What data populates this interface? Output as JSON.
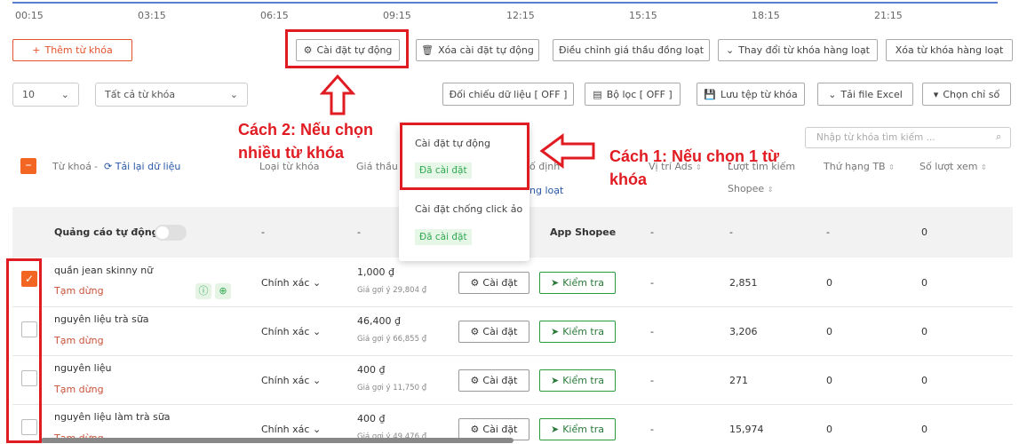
{
  "timeline": {
    "ticks": [
      "00:15",
      "03:15",
      "06:15",
      "09:15",
      "12:15",
      "15:15",
      "18:15",
      "21:15"
    ]
  },
  "toolbar1": {
    "add_keyword": "Thêm từ khóa",
    "auto_setup": "Cài đặt tự động",
    "remove_auto": "Xóa cài đặt tự động",
    "bulk_bid": "Điều chỉnh giá thầu đồng loạt",
    "bulk_change": "Thay đổi từ khóa hàng loạt",
    "bulk_delete": "Xóa từ khóa hàng loạt"
  },
  "toolbar2": {
    "page_size": "10",
    "filter_all": "Tất cả từ khóa",
    "reconcile": "Đối chiếu dữ liệu [ OFF ]",
    "filter": "Bộ lọc [ OFF ]",
    "save": "Lưu tệp từ khóa",
    "download": "Tải file Excel",
    "choose_metric": "Chọn chỉ số"
  },
  "search": {
    "placeholder": "Nhập từ khóa tìm kiếm ..."
  },
  "annotations": {
    "method2_line1": "Cách 2: Nếu chọn",
    "method2_line2": "nhiều từ khóa",
    "method1_line1": "Cách 1: Nếu chọn 1 từ",
    "method1_line2": "khóa"
  },
  "popup": {
    "auto_setup": "Cài đặt tự động",
    "auto_status": "Đã cài đặt",
    "anti_click": "Cài đặt chống click ảo",
    "anti_status": "Đã cài đặt"
  },
  "table": {
    "headers": {
      "keyword": "Từ khoá",
      "reload": "Tải lại dữ liệu",
      "type": "Loại từ khóa",
      "bid": "Giá thầu",
      "fixed_partial": "ố định",
      "bulk_partial": "ng loạt",
      "ads_position": "Vị trí Ads",
      "search_volume": "Lượt tìm kiếm",
      "search_volume2": "Shopee",
      "avg_rank": "Thứ hạng TB",
      "views": "Số lượt xem"
    },
    "auto_row": {
      "label": "Quảng cáo tự động",
      "type": "-",
      "bid": "-",
      "position": "App Shopee",
      "ads": "-",
      "search": "-",
      "rank": "-",
      "views": "0"
    },
    "rows": [
      {
        "keyword": "quần jean skinny nữ",
        "status": "Tạm dừng",
        "type": "Chính xác",
        "bid": "1,000 ₫",
        "suggest": "Giá gợi ý 29,804 ₫",
        "setup": "Cài đặt",
        "check": "Kiểm tra",
        "ads": "-",
        "search": "2,851",
        "rank": "0",
        "views": "0",
        "checked": true
      },
      {
        "keyword": "nguyên liệu trà sữa",
        "status": "Tạm dừng",
        "type": "Chính xác",
        "bid": "46,400 ₫",
        "suggest": "Giá gợi ý 66,855 ₫",
        "setup": "Cài đặt",
        "check": "Kiểm tra",
        "ads": "-",
        "search": "3,206",
        "rank": "0",
        "views": "0",
        "checked": false
      },
      {
        "keyword": "nguyên liệu",
        "status": "Tạm dừng",
        "type": "Chính xác",
        "bid": "400 ₫",
        "suggest": "Giá gợi ý 11,750 ₫",
        "setup": "Cài đặt",
        "check": "Kiểm tra",
        "ads": "-",
        "search": "271",
        "rank": "0",
        "views": "0",
        "checked": false
      },
      {
        "keyword": "nguyên liệu làm trà sữa",
        "status": "Tạm dừng",
        "type": "Chính xác",
        "bid": "400 ₫",
        "suggest": "Giá gợi ý 49,476 ₫",
        "setup": "Cài đặt",
        "check": "Kiểm tra",
        "ads": "-",
        "search": "15,974",
        "rank": "0",
        "views": "0",
        "checked": false
      }
    ]
  },
  "colors": {
    "accent": "#f26522",
    "annotation": "#e01b22",
    "success": "#2fa84f"
  }
}
